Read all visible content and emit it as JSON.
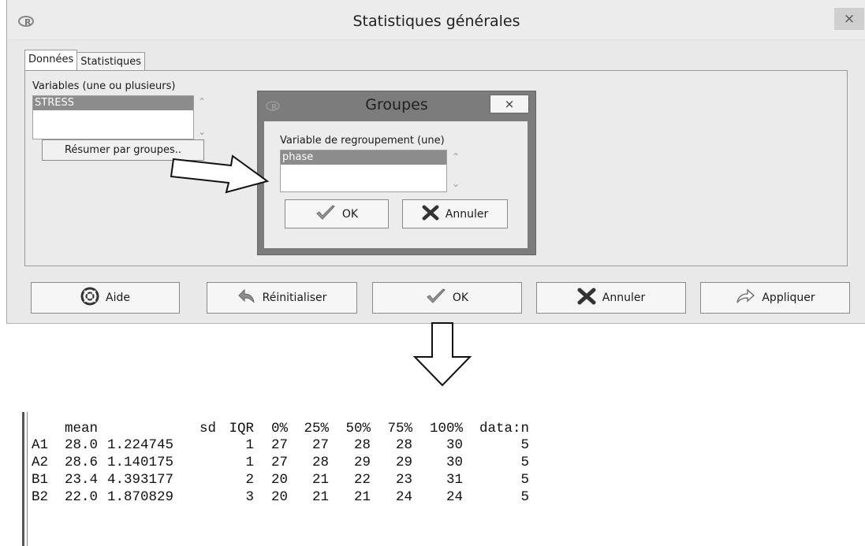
{
  "dialog": {
    "title": "Statistiques générales",
    "close_label": "×",
    "tabs": [
      "Données",
      "Statistiques"
    ],
    "variables_label": "Variables (une ou plusieurs)",
    "variables_list": [
      "STRESS"
    ],
    "group_button_label": "Résumer par groupes..",
    "buttons": {
      "help": "Aide",
      "reset": "Réinitialiser",
      "ok": "OK",
      "cancel": "Annuler",
      "apply": "Appliquer"
    }
  },
  "subdialog": {
    "title": "Groupes",
    "close_label": "×",
    "group_var_label": "Variable de regroupement (une)",
    "group_var_list": [
      "phase"
    ],
    "ok_label": "OK",
    "cancel_label": "Annuler"
  },
  "console": {
    "headers": [
      "mean",
      "sd",
      "IQR",
      "0%",
      "25%",
      "50%",
      "75%",
      "100%",
      "data:n"
    ],
    "rows": [
      {
        "name": "A1",
        "values": [
          "28.0",
          "1.224745",
          "1",
          "27",
          "27",
          "28",
          "28",
          "30",
          "5"
        ]
      },
      {
        "name": "A2",
        "values": [
          "28.6",
          "1.140175",
          "1",
          "27",
          "28",
          "29",
          "29",
          "30",
          "5"
        ]
      },
      {
        "name": "B1",
        "values": [
          "23.4",
          "4.393177",
          "2",
          "20",
          "21",
          "22",
          "23",
          "31",
          "5"
        ]
      },
      {
        "name": "B2",
        "values": [
          "22.0",
          "1.870829",
          "3",
          "20",
          "21",
          "21",
          "24",
          "24",
          "5"
        ]
      }
    ]
  },
  "icons": {
    "app": "r-logo-icon",
    "help": "lifebuoy-icon",
    "reset": "undo-arrow-icon",
    "ok": "checkmark-icon",
    "cancel": "x-mark-icon",
    "apply": "redo-arrow-icon"
  }
}
